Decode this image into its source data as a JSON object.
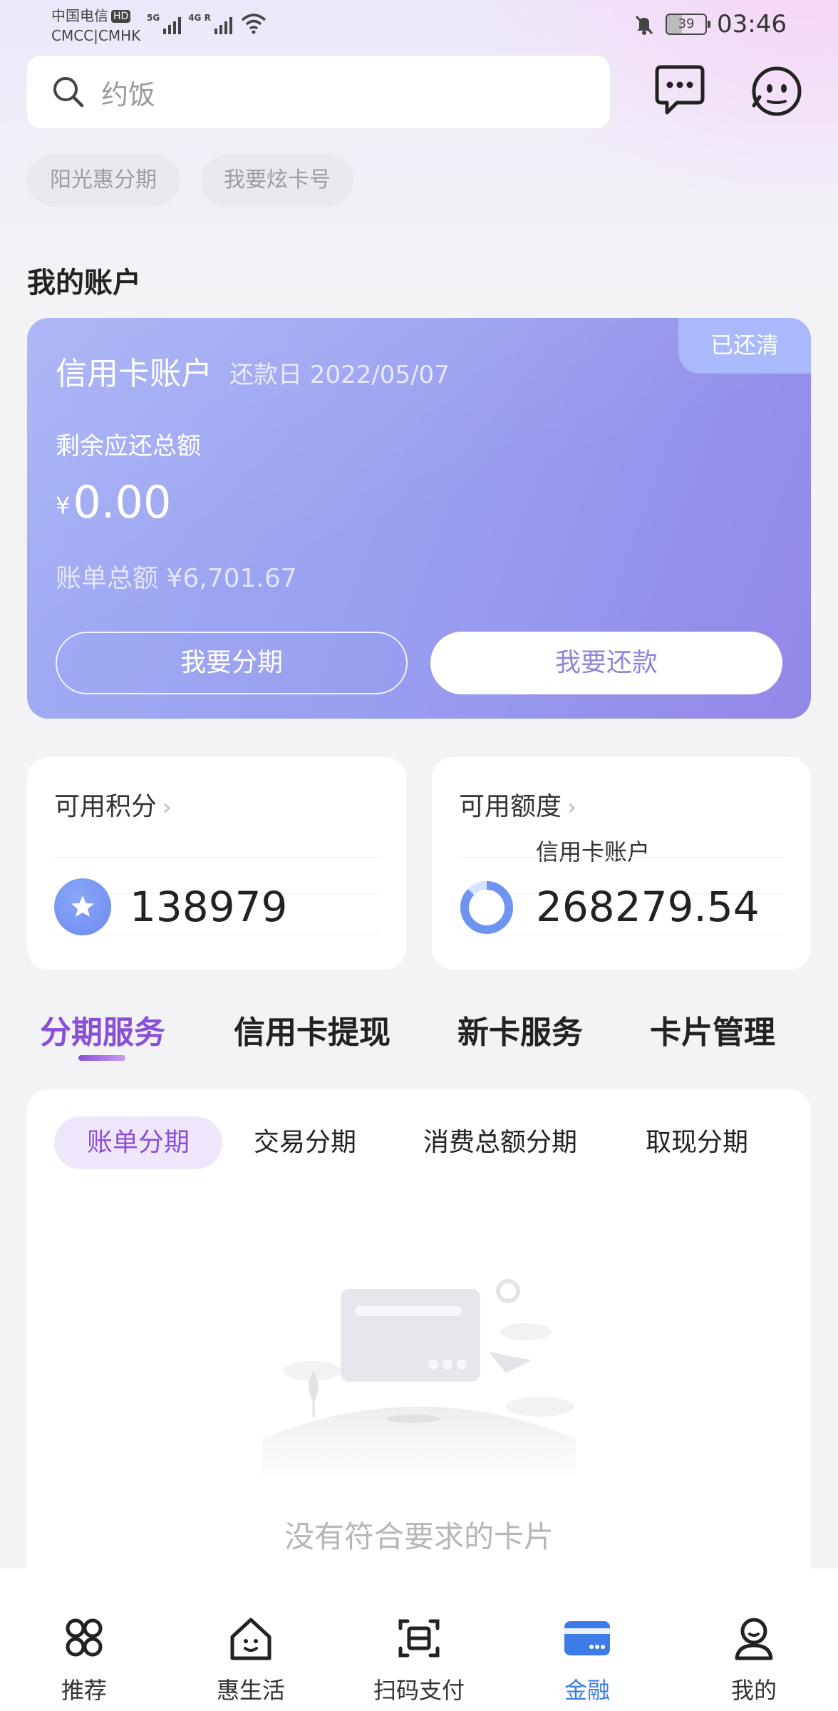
{
  "status_bar": {
    "carrier_1": "中国电信",
    "carrier_hd": "HD",
    "carrier_2": "CMCC|CMHK",
    "net_1": "5G",
    "net_2": "4G R",
    "battery": "39",
    "time": "03:46"
  },
  "search": {
    "placeholder": "约饭"
  },
  "chips": [
    "阳光惠分期",
    "我要炫卡号"
  ],
  "section_title": "我的账户",
  "account_card": {
    "status_badge": "已还清",
    "title": "信用卡账户",
    "due_date": "还款日 2022/05/07",
    "remaining_label": "剩余应还总额",
    "currency": "¥",
    "remaining_amount": "0.00",
    "bill_total": "账单总额 ¥6,701.67",
    "installment_button": "我要分期",
    "repay_button": "我要还款"
  },
  "points_card": {
    "title": "可用积分",
    "value": "138979"
  },
  "credit_card": {
    "title": "可用额度",
    "subtitle": "信用卡账户",
    "value": "268279.54"
  },
  "service_tabs": [
    "分期服务",
    "信用卡提现",
    "新卡服务",
    "卡片管理"
  ],
  "sub_tabs": [
    "账单分期",
    "交易分期",
    "消费总额分期",
    "取现分期"
  ],
  "empty_message": "没有符合要求的卡片",
  "bottom_nav": [
    {
      "label": "推荐",
      "icon": "grid-icon"
    },
    {
      "label": "惠生活",
      "icon": "house-icon"
    },
    {
      "label": "扫码支付",
      "icon": "scan-icon"
    },
    {
      "label": "金融",
      "icon": "card-icon"
    },
    {
      "label": "我的",
      "icon": "person-icon"
    }
  ],
  "colors": {
    "accent_purple": "#8a4fd8",
    "nav_active_blue": "#3d7ce8",
    "card_gradient_start": "#a3aef5",
    "card_gradient_end": "#9287e8"
  }
}
